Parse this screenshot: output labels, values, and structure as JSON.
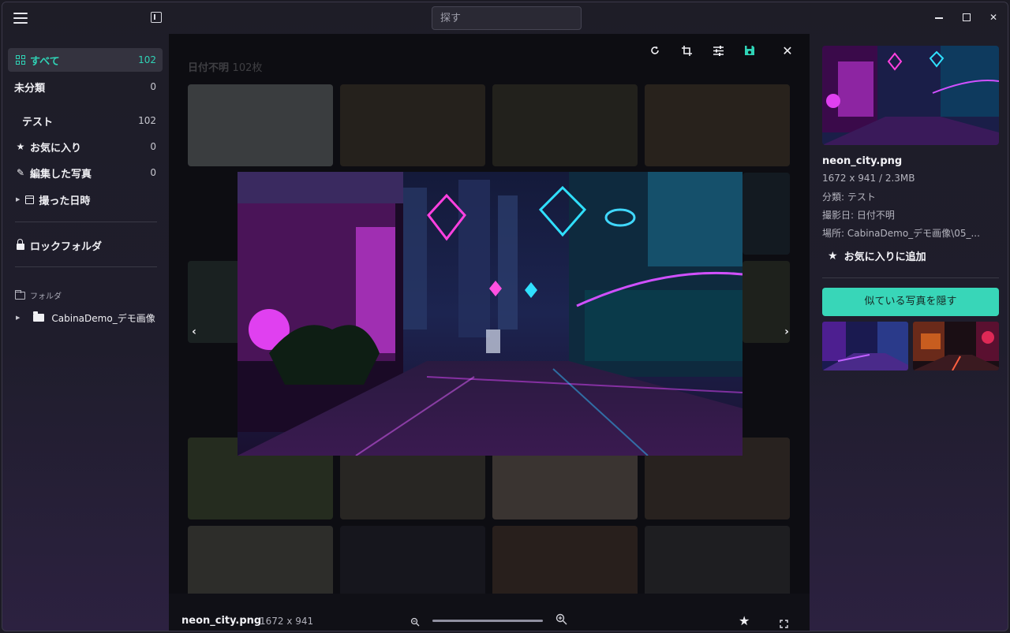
{
  "titlebar": {
    "search_placeholder": "探す"
  },
  "sidebar": {
    "items": [
      {
        "label": "すべて",
        "count": "102",
        "icon": "grid-icon",
        "active": true
      },
      {
        "label": "未分類",
        "count": "0"
      },
      {
        "label": "テスト",
        "count": "102"
      },
      {
        "label": "お気に入り",
        "count": "0",
        "icon": "star-icon"
      },
      {
        "label": "編集した写真",
        "count": "0",
        "icon": "pencil-icon"
      },
      {
        "label": "撮った日時",
        "icon": "calendar-icon"
      }
    ],
    "lock_folder": "ロックフォルダ",
    "folders_section": "フォルダ",
    "folder_item": "CabinaDemo_デモ画像"
  },
  "main": {
    "group_title": "日付不明",
    "group_count": "102枚"
  },
  "viewer": {
    "file_name": "neon_city.png",
    "dimensions": "1672 x 941",
    "zoom_level": 1.0
  },
  "details": {
    "name": "neon_city.png",
    "size": "1672 x 941 / 2.3MB",
    "category": "分類: テスト",
    "date": "撮影日: 日付不明",
    "location": "場所: CabinaDemo_デモ画像\\05_...",
    "fav_label": "お気に入りに追加",
    "similar_button": "似ている写真を隠す"
  },
  "colors": {
    "accent": "#2fd3b6",
    "button": "#38d6b8"
  }
}
